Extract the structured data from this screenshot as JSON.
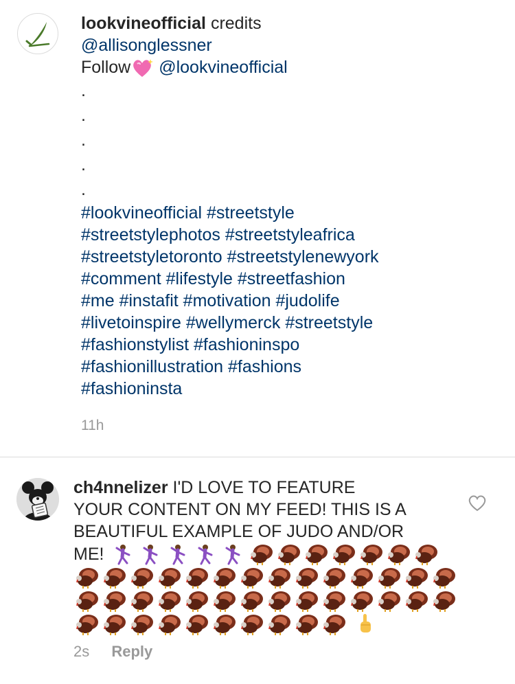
{
  "post": {
    "username": "lookvineofficial",
    "credits_word": "credits",
    "mention_credit": "@allisonglessner",
    "follow_word": "Follow",
    "follow_emoji": "sparkling-heart",
    "mention_follow": "@lookvineofficial",
    "dots": [
      ".",
      ".",
      ".",
      ".",
      "."
    ],
    "hashtag_lines": [
      "#lookvineofficial #streetstyle",
      "#streetstylephotos #streetstyleafrica",
      "#streetstyletoronto #streetstylenewyork",
      "#comment #lifestyle #streetfashion",
      "#me #instafit #motivation #judolife",
      "#livetoinspire #wellymerck #streetstyle",
      "#fashionstylist #fashioninspo",
      "#fashionillustration #fashions",
      "#fashioninsta"
    ],
    "timestamp": "11h"
  },
  "comment": {
    "username": "ch4nnelizer",
    "text_lines": [
      "I'D LOVE TO FEATURE",
      "YOUR CONTENT ON MY FEED! THIS IS A",
      "BEAUTIFUL EXAMPLE OF JUDO AND/OR",
      "ME!"
    ],
    "emoji_dancers": 5,
    "emoji_turkeys": 45,
    "emoji_hand": "pointing-finger",
    "timestamp": "2s",
    "reply_label": "Reply"
  },
  "colors": {
    "link": "#003569",
    "text": "#262626",
    "muted": "#999999",
    "divider": "#dbdbdb",
    "leaf": "#4a7a2a"
  }
}
